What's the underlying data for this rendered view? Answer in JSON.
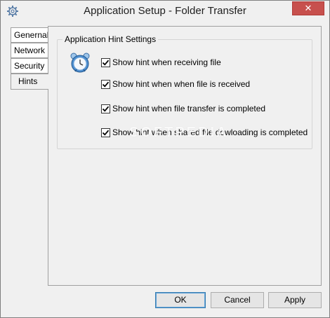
{
  "window": {
    "title": "Application Setup - Folder Transfer",
    "close_glyph": "✕"
  },
  "tabs": [
    {
      "label": "Genernal",
      "active": false
    },
    {
      "label": "Network",
      "active": false
    },
    {
      "label": "Security",
      "active": false
    },
    {
      "label": "Hints",
      "active": true
    }
  ],
  "hint_settings": {
    "group_title": "Application Hint Settings",
    "icon": "alarm-clock-icon",
    "options": [
      {
        "label": "Show hint when receiving file",
        "checked": true
      },
      {
        "label": "Show hint when when file is received",
        "checked": true
      },
      {
        "label": "Show hint when file transfer is completed",
        "checked": true
      },
      {
        "label": "Show hint when shared file dowloading is completed",
        "checked": true
      }
    ]
  },
  "buttons": {
    "ok": "OK",
    "cancel": "Cancel",
    "apply": "Apply"
  },
  "watermark": "SOFTPEDIA",
  "colors": {
    "close_button": "#c7504d",
    "window_bg": "#f0f0f0"
  }
}
